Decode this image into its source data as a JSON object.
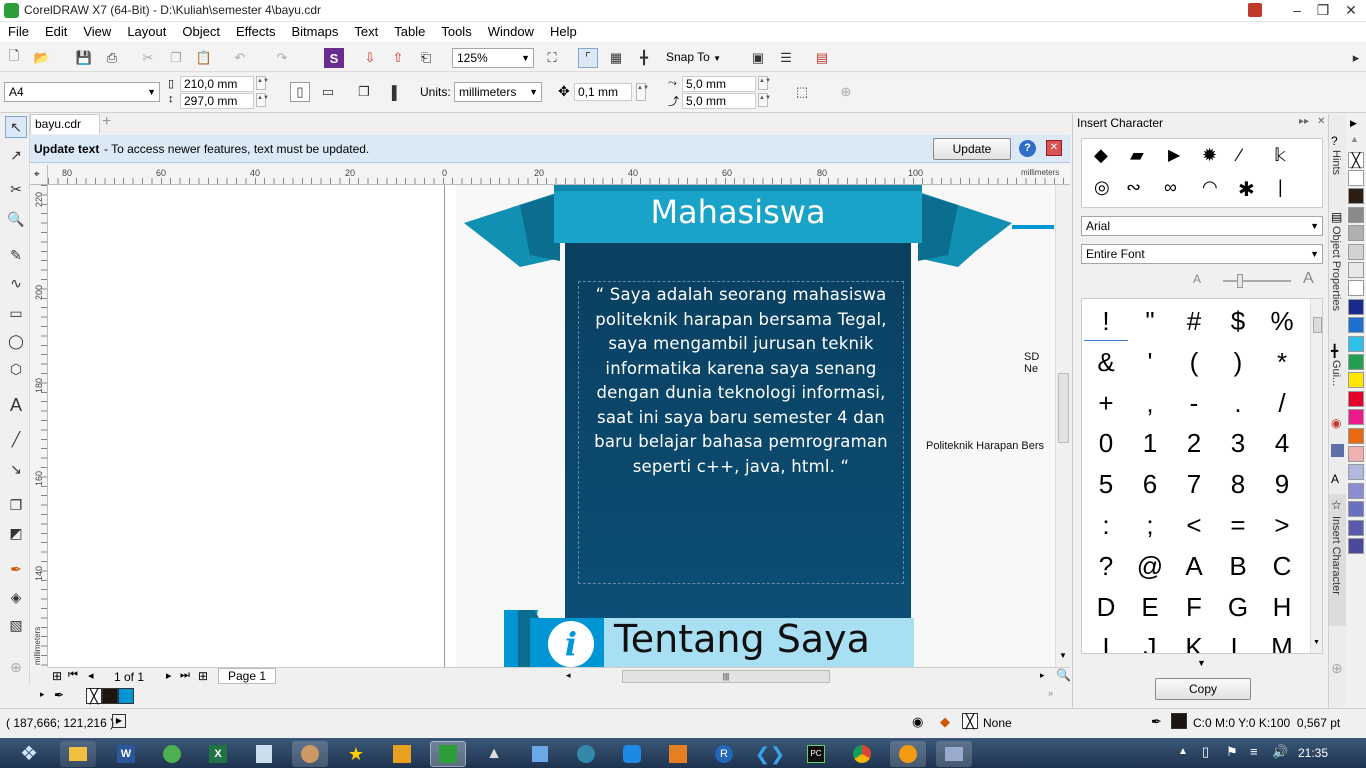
{
  "window": {
    "title": "CorelDRAW X7 (64-Bit) - D:\\Kuliah\\semester 4\\bayu.cdr",
    "controls": [
      "–",
      "❐",
      "✕"
    ]
  },
  "menu": [
    "File",
    "Edit",
    "View",
    "Layout",
    "Object",
    "Effects",
    "Bitmaps",
    "Text",
    "Table",
    "Tools",
    "Window",
    "Help"
  ],
  "toolbar": {
    "zoom": "125%",
    "snap_to": "Snap To"
  },
  "property_bar": {
    "page_size": "A4",
    "width": "210,0 mm",
    "height": "297,0 mm",
    "units_label": "Units:",
    "units": "millimeters",
    "nudge": "0,1 mm",
    "dup_x": "5,0 mm",
    "dup_y": "5,0 mm"
  },
  "document_tab": "bayu.cdr",
  "infobar": {
    "title": "Update text",
    "message": "-  To access newer features, text must be updated.",
    "button": "Update"
  },
  "ruler": {
    "unit": "millimeters",
    "h_ticks": [
      "80",
      "60",
      "40",
      "20",
      "0",
      "20",
      "40",
      "60",
      "80",
      "100"
    ],
    "v_ticks": [
      "220",
      "200",
      "180",
      "160",
      "140"
    ],
    "v_unit": "millimeters"
  },
  "design": {
    "ribbon_title": "Mahasiswa",
    "quote": "“ Saya adalah seorang mahasiswa politeknik harapan bersama Tegal, saya mengambil jurusan teknik informatika karena saya senang dengan dunia teknologi informasi, saat ini saya baru semester 4 dan baru belajar bahasa pemrograman seperti c++, java, html. “",
    "section_title": "Tentang Saya",
    "info_icon": "i",
    "side_text_1": "SD Ne",
    "side_text_2": "Politeknik Harapan Bers",
    "colors": {
      "ribbon": "#1aa3c8",
      "panel": "#0b4a6e",
      "section_bar": "#a8dff2",
      "accent": "#0096d6"
    }
  },
  "page_nav": {
    "counter": "1 of 1",
    "page_tab": "Page 1"
  },
  "status": {
    "coords": "( 187,666; 121,216 )",
    "fill": "None",
    "outline": "C:0 M:0 Y:0 K:100  0,567 pt"
  },
  "docker": {
    "title": "Insert Character",
    "font": "Arial",
    "subset": "Entire Font",
    "glyphs": [
      "!",
      "\"",
      "#",
      "$",
      "%",
      "&",
      "'",
      "(",
      ")",
      "*",
      "+",
      ",",
      "-",
      ".",
      "/",
      "0",
      "1",
      "2",
      "3",
      "4",
      "5",
      "6",
      "7",
      "8",
      "9",
      ":",
      ";",
      "<",
      "=",
      ">",
      "?",
      "@",
      "A",
      "B",
      "C",
      "D",
      "E",
      "F",
      "G",
      "H",
      "I",
      "J",
      "K",
      "L",
      "M"
    ],
    "copy_button": "Copy"
  },
  "docker_tabs": [
    "Hints",
    "Object Properties",
    "Gui...",
    "Insert Character"
  ],
  "taskbar": {
    "time": "21:35"
  }
}
